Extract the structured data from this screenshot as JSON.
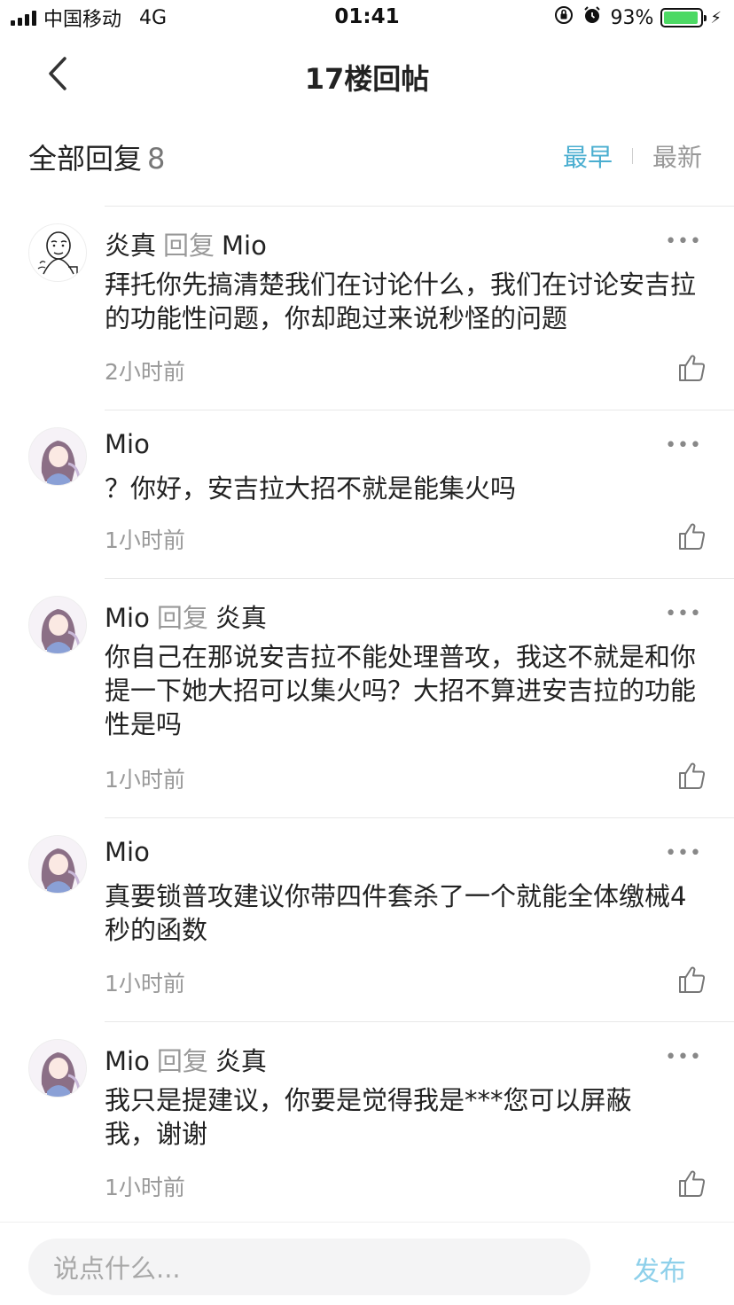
{
  "status_bar": {
    "carrier": "中国移动",
    "network": "4G",
    "time": "01:41",
    "battery_percent": "93%",
    "battery_level": 0.93,
    "battery_color": "#4cd964"
  },
  "nav": {
    "title": "17楼回帖",
    "back_icon": "chevron-left-icon"
  },
  "header": {
    "title": "全部回复",
    "count": "8",
    "sort_earliest": "最早",
    "sort_newest": "最新",
    "active_color": "#4aaed0"
  },
  "comments": [
    {
      "author": "炎真",
      "reply_word": "回复",
      "reply_to": "Mio",
      "text": "拜托你先搞清楚我们在讨论什么，我们在讨论安吉拉的功能性问题，你却跑过来说秒怪的问题",
      "time": "2小时前",
      "avatar": "meme-face-avatar"
    },
    {
      "author": "Mio",
      "reply_word": "",
      "reply_to": "",
      "text": "？你好，安吉拉大招不就是能集火吗",
      "time": "1小时前",
      "avatar": "anime-girl-avatar"
    },
    {
      "author": "Mio",
      "reply_word": "回复",
      "reply_to": "炎真",
      "text": "你自己在那说安吉拉不能处理普攻，我这不就是和你提一下她大招可以集火吗？大招不算进安吉拉的功能性是吗",
      "time": "1小时前",
      "avatar": "anime-girl-avatar"
    },
    {
      "author": "Mio",
      "reply_word": "",
      "reply_to": "",
      "text": "真要锁普攻建议你带四件套杀了一个就能全体缴械4秒的函数",
      "time": "1小时前",
      "avatar": "anime-girl-avatar"
    },
    {
      "author": "Mio",
      "reply_word": "回复",
      "reply_to": "炎真",
      "text": "我只是提建议，你要是觉得我是***您可以屏蔽我，谢谢",
      "time": "1小时前",
      "avatar": "anime-girl-avatar"
    }
  ],
  "more_glyph": "•••",
  "bottom": {
    "input_placeholder": "说点什么...",
    "publish_label": "发布",
    "publish_color": "#8ed0ea"
  }
}
